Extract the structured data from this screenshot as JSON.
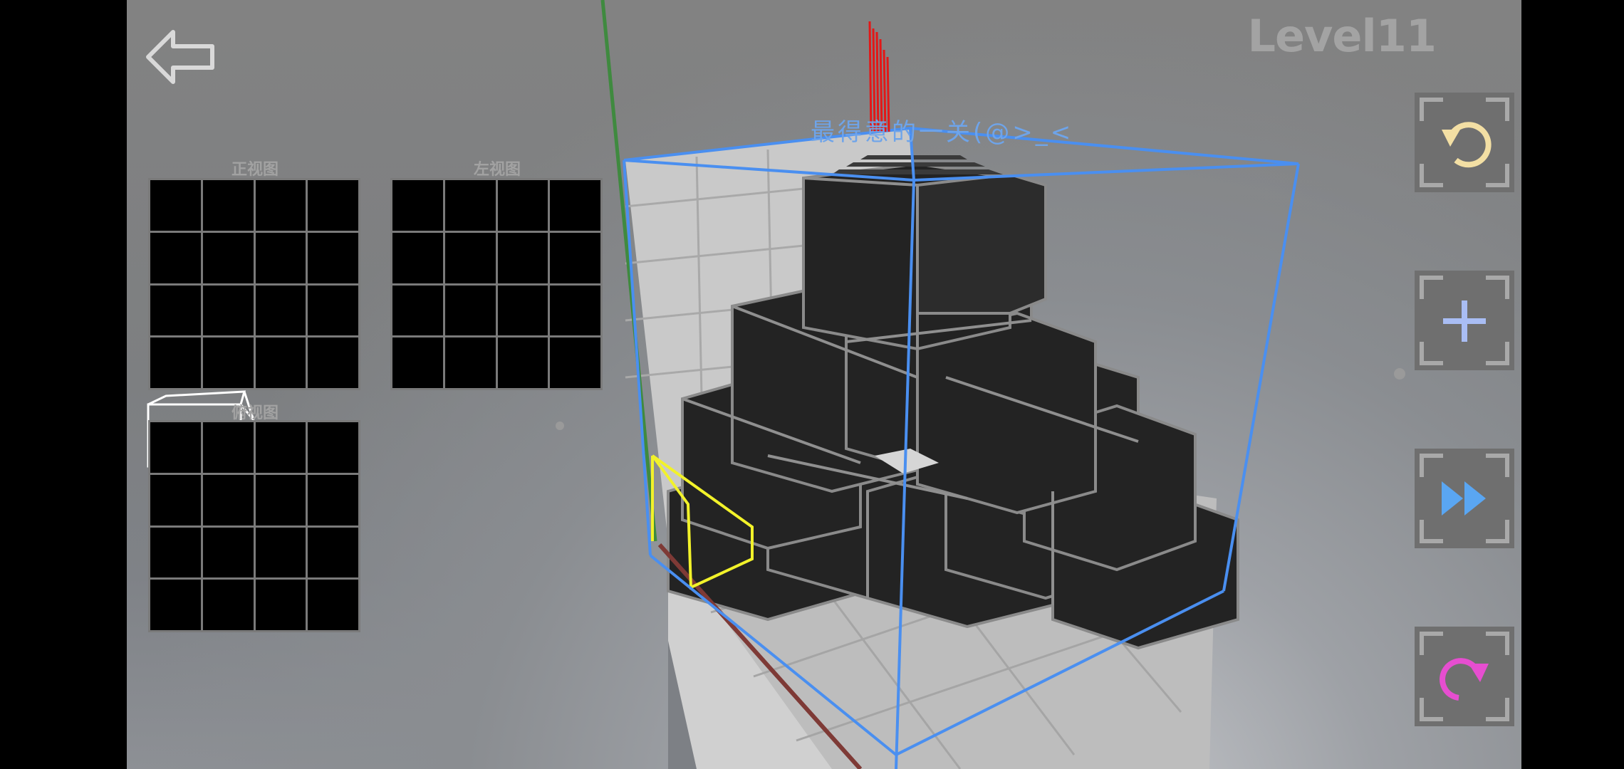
{
  "header": {
    "level_title": "Level11"
  },
  "views": {
    "front_label": "正视图",
    "left_label": "左视图",
    "top_label": "俯视图"
  },
  "hint": {
    "text": "最得意的一关(@>_<"
  },
  "controls": [
    {
      "name": "undo",
      "icon": "undo-arrow-icon",
      "color": "#f3dfa4"
    },
    {
      "name": "add",
      "icon": "plus-icon",
      "color": "#a9bdf4"
    },
    {
      "name": "fast-forward",
      "icon": "fast-forward-icon",
      "color": "#5aa6f2"
    },
    {
      "name": "redo",
      "icon": "redo-arrow-icon",
      "color": "#e64ed0"
    }
  ],
  "colors": {
    "axis_y": "#3f8a3f",
    "axis_x": "#7e3a36",
    "selection": "#f2f22a",
    "bounds": "#4a8ff0",
    "marker": "#e31717"
  }
}
